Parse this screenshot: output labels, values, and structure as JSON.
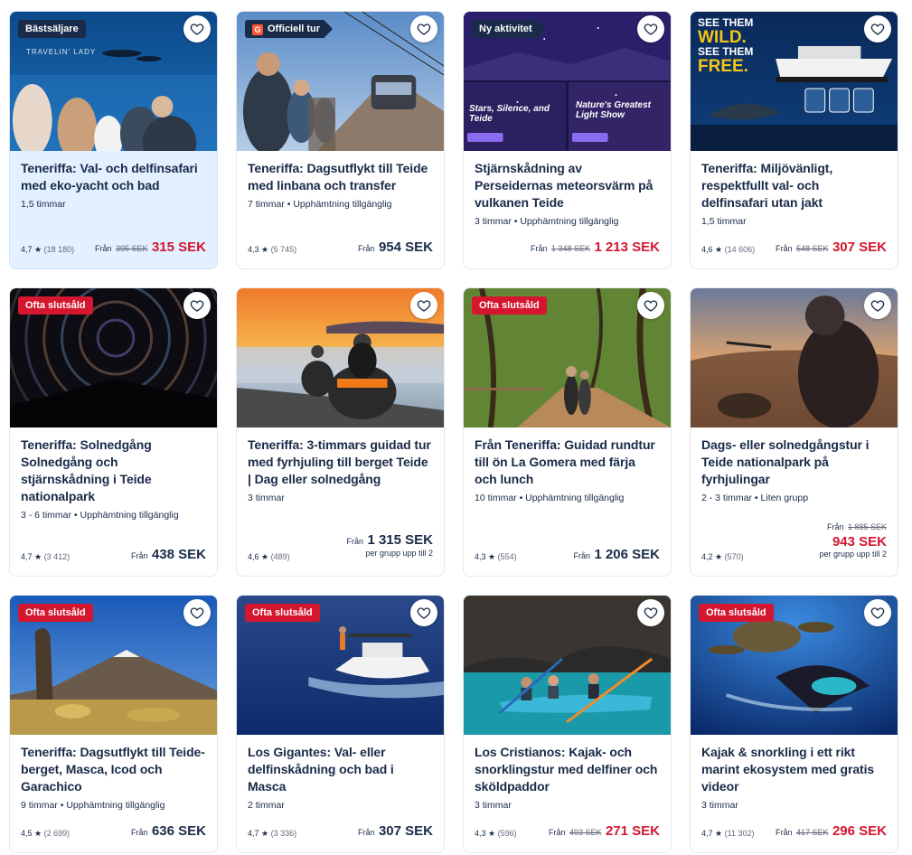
{
  "cards": [
    {
      "badge": "Bästsäljare",
      "title": "Teneriffa: Val- och delfinsafari med eko-yacht och bad",
      "meta": "1,5 timmar",
      "rating": "4,7 ★",
      "reviews": "(18 180)",
      "from": "Från",
      "old_price": "395 SEK",
      "price": "315 SEK",
      "watermark": "TRAVELIN' LADY"
    },
    {
      "badge": "Officiell tur",
      "badge_icon": "G",
      "title": "Teneriffa: Dagsutflykt till Teide med linbana och transfer",
      "meta": "7 timmar • Upphämtning tillgänglig",
      "rating": "4,3 ★",
      "reviews": "(5 745)",
      "from": "Från",
      "price": "954 SEK"
    },
    {
      "badge": "Ny aktivitet",
      "title": "Stjärnskådning av Perseidernas meteorsvärm på vulkanen Teide",
      "meta": "3 timmar • Upphämtning tillgänglig",
      "from": "Från",
      "old_price": "1 348 SEK",
      "price": "1 213 SEK",
      "poster_left": "Stars, Silence, and Teide",
      "poster_right": "Nature's Greatest Light Show"
    },
    {
      "title": "Teneriffa: Miljövänligt, respektfullt val- och delfinsafari utan jakt",
      "meta": "1,5 timmar",
      "rating": "4,6 ★",
      "reviews": "(14 606)",
      "from": "Från",
      "old_price": "548 SEK",
      "price": "307 SEK",
      "poster_line1": "SEE THEM",
      "poster_line2": "WILD.",
      "poster_line3": "SEE THEM",
      "poster_line4": "FREE."
    },
    {
      "badge": "Ofta slutsåld",
      "title": "Teneriffa: Solnedgång Solnedgång och stjärnskådning i Teide nationalpark",
      "meta": "3 - 6 timmar • Upphämtning tillgänglig",
      "rating": "4,7 ★",
      "reviews": "(3 412)",
      "from": "Från",
      "price": "438 SEK"
    },
    {
      "title": "Teneriffa: 3-timmars guidad tur med fyrhjuling till berget Teide | Dag eller solnedgång",
      "meta": "3 timmar",
      "rating": "4,6 ★",
      "reviews": "(489)",
      "from": "Från",
      "price": "1 315 SEK",
      "price_sub": "per grupp upp till 2"
    },
    {
      "badge": "Ofta slutsåld",
      "title": "Från Teneriffa: Guidad rundtur till ön La Gomera med färja och lunch",
      "meta": "10 timmar • Upphämtning tillgänglig",
      "rating": "4,3 ★",
      "reviews": "(554)",
      "from": "Från",
      "price": "1 206 SEK"
    },
    {
      "title": "Dags- eller solnedgångstur i Teide nationalpark på fyrhjulingar",
      "meta": "2 - 3 timmar • Liten grupp",
      "rating": "4,2 ★",
      "reviews": "(570)",
      "from": "Från",
      "old_price": "1 885 SEK",
      "price": "943 SEK",
      "price_sub": "per grupp upp till 2"
    },
    {
      "badge": "Ofta slutsåld",
      "title": "Teneriffa: Dagsutflykt till Teide-berget, Masca, Icod och Garachico",
      "meta": "9 timmar • Upphämtning tillgänglig",
      "rating": "4,5 ★",
      "reviews": "(2 699)",
      "from": "Från",
      "price": "636 SEK"
    },
    {
      "badge": "Ofta slutsåld",
      "title": "Los Gigantes: Val- eller delfinskådning och bad i Masca",
      "meta": "2 timmar",
      "rating": "4,7 ★",
      "reviews": "(3 336)",
      "from": "Från",
      "price": "307 SEK"
    },
    {
      "title": "Los Cristianos: Kajak- och snorklingstur med delfiner och sköldpaddor",
      "meta": "3 timmar",
      "rating": "4,3 ★",
      "reviews": "(596)",
      "from": "Från",
      "old_price": "493 SEK",
      "price": "271 SEK"
    },
    {
      "badge": "Ofta slutsåld",
      "title": "Kajak & snorkling i ett rikt marint ekosystem med gratis videor",
      "meta": "3 timmar",
      "rating": "4,7 ★",
      "reviews": "(11 302)",
      "from": "Från",
      "old_price": "417 SEK",
      "price": "296 SEK"
    }
  ],
  "colors": {
    "text": "#1a2b49",
    "sale": "#d4162e",
    "badge_red": "#d4162e",
    "badge_dark": "#1a2b49",
    "highlight_bg": "#e3f0ff"
  }
}
